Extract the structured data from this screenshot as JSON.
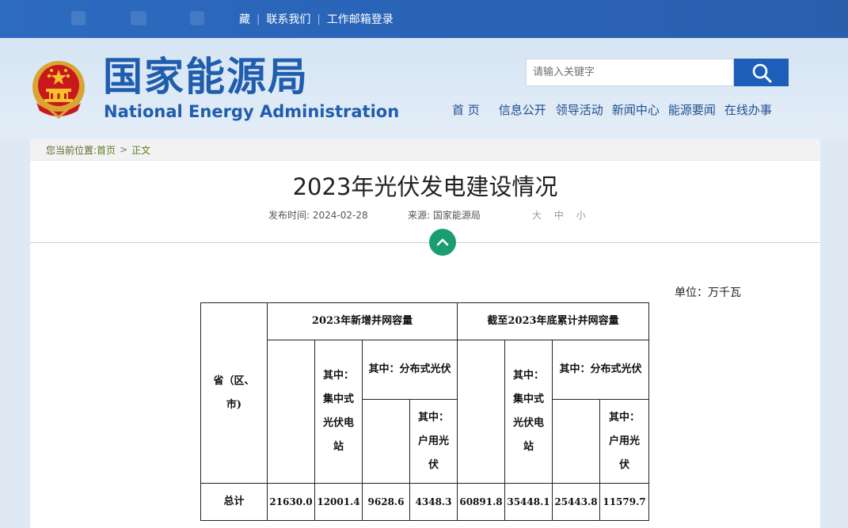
{
  "top_links": [
    "藏",
    "联系我们",
    "工作邮箱登录"
  ],
  "site": {
    "name_cn": "国家能源局",
    "name_en": "National Energy Administration"
  },
  "search": {
    "placeholder": "请输入关键字",
    "icon": "search-icon"
  },
  "nav": [
    "首 页",
    "信息公开",
    "领导活动",
    "新闻中心",
    "能源要闻",
    "在线办事"
  ],
  "breadcrumb": {
    "prefix": "您当前位置:",
    "home": "首页",
    "current": "正文",
    "sep": ">"
  },
  "article": {
    "title": "2023年光伏发电建设情况",
    "publish_label": "发布时间:",
    "publish_date": "2024-02-28",
    "source_label": "来源:",
    "source": "国家能源局",
    "sizes": [
      "大",
      "中",
      "小"
    ]
  },
  "table": {
    "unit": "单位：万千瓦",
    "col_province": "省（区、市)",
    "group_new": "2023年新增并网容量",
    "group_cum": "截至2023年底累计并网容量",
    "sub_central": "其中：集中式光伏电站",
    "sub_distributed": "其中：分布式光伏",
    "sub_household": "其中：户用光伏",
    "rows": [
      {
        "name": "总计",
        "values": [
          "21630.0",
          "12001.4",
          "9628.6",
          "4348.3",
          "60891.8",
          "35448.1",
          "25443.8",
          "11579.7"
        ]
      }
    ]
  },
  "colors": {
    "topbar": "#2a63b6",
    "brand_blue": "#1f5dae",
    "accent_green": "#1a9e70"
  }
}
